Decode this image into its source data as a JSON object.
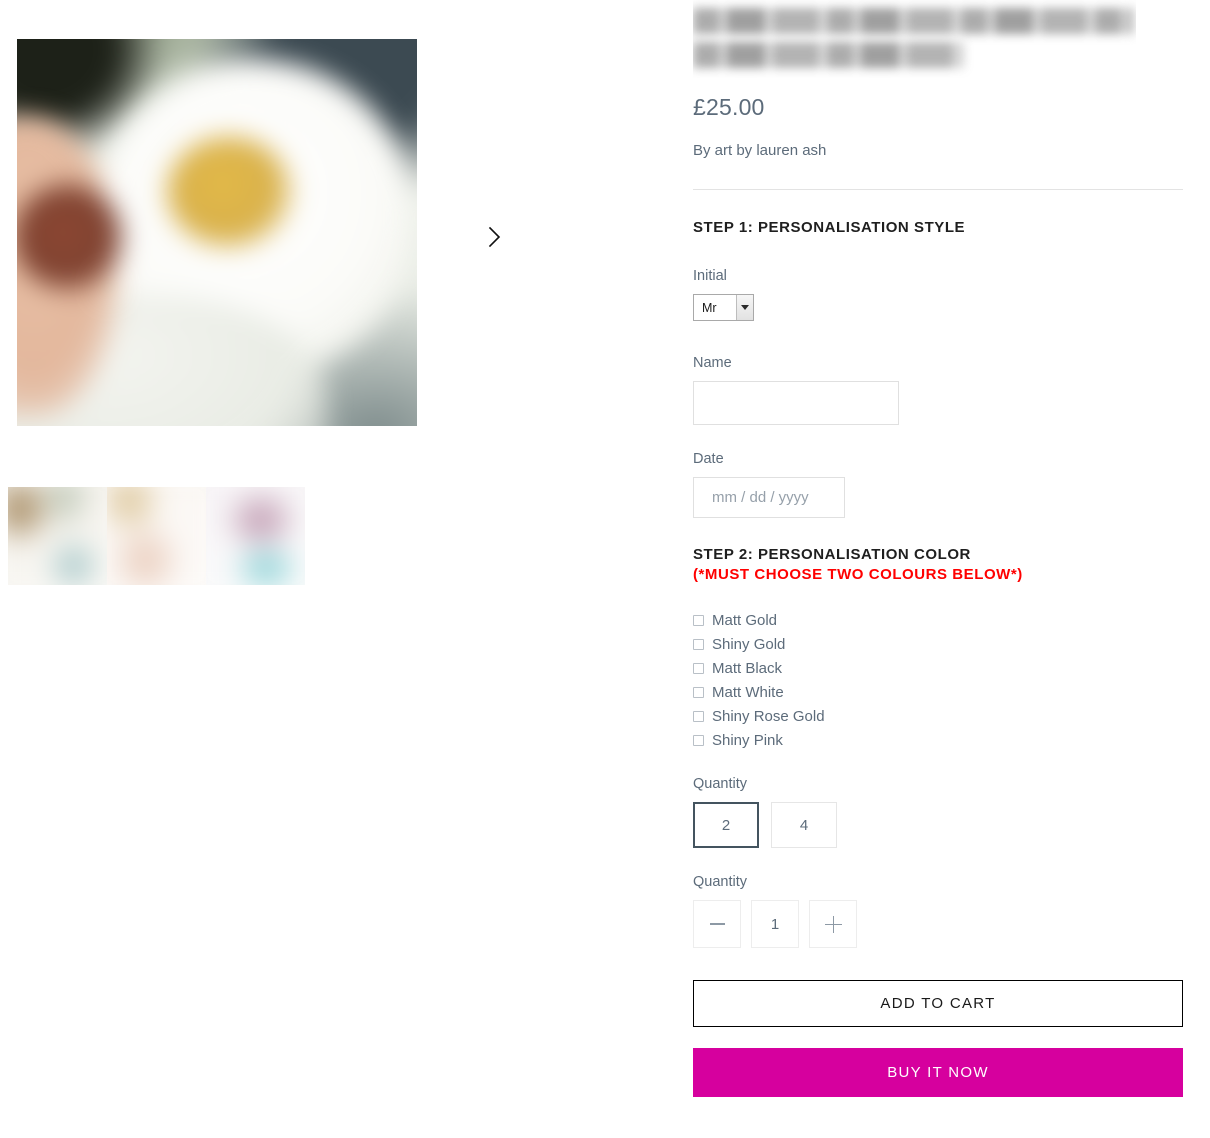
{
  "product": {
    "title_redacted": true,
    "price": "£25.00",
    "vendor": "By art by lauren ash"
  },
  "gallery": {
    "next_arrow_label": "Next",
    "thumbnails": [
      {
        "name": "thumbnail-1"
      },
      {
        "name": "thumbnail-2"
      },
      {
        "name": "thumbnail-3"
      }
    ]
  },
  "step1": {
    "heading": "STEP 1: PERSONALISATION STYLE",
    "initial": {
      "label": "Initial",
      "value": "Mr",
      "options": [
        "Mr"
      ]
    },
    "name": {
      "label": "Name",
      "value": "",
      "placeholder": ""
    },
    "date": {
      "label": "Date",
      "value": "",
      "placeholder": "mm / dd / yyyy"
    }
  },
  "step2": {
    "heading": "STEP 2: PERSONALISATION COLOR",
    "warning": "(*MUST CHOOSE TWO COLOURS BELOW*)",
    "warning_color": "#ff0000",
    "colors": [
      {
        "label": "Matt Gold",
        "checked": false
      },
      {
        "label": "Shiny Gold",
        "checked": false
      },
      {
        "label": "Matt Black",
        "checked": false
      },
      {
        "label": "Matt White",
        "checked": false
      },
      {
        "label": "Shiny Rose Gold",
        "checked": false
      },
      {
        "label": "Shiny Pink",
        "checked": false
      }
    ]
  },
  "quantity_variant": {
    "label": "Quantity",
    "options": [
      {
        "value": "2",
        "selected": true
      },
      {
        "value": "4",
        "selected": false
      }
    ]
  },
  "quantity_stepper": {
    "label": "Quantity",
    "decrement_icon": "minus-icon",
    "value": "1",
    "increment_icon": "plus-icon"
  },
  "actions": {
    "add_to_cart": "ADD TO CART",
    "buy_it_now": "BUY IT NOW",
    "buy_color": "#d6009e"
  }
}
